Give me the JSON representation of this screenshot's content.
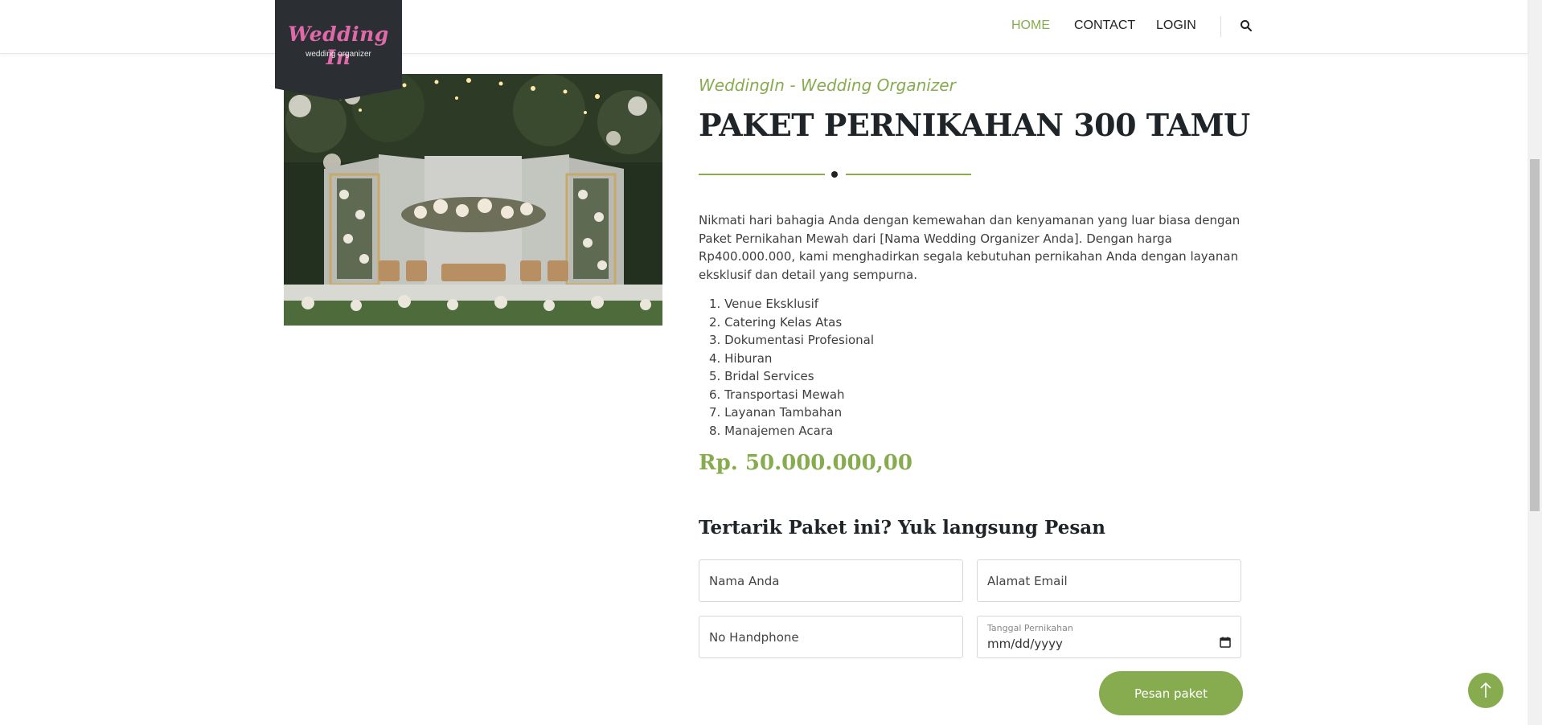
{
  "brand": {
    "title": "Wedding In",
    "subtitle": "wedding organizer",
    "colors": {
      "accent": "#87ac4f",
      "logo_bg": "#2b2f33",
      "logo_text": "#e06aa9",
      "heading": "#1f2428"
    }
  },
  "nav": {
    "items": [
      {
        "label": "HOME",
        "active": true
      },
      {
        "label": "CONTACT",
        "active": false
      },
      {
        "label": "LOGIN",
        "active": false
      }
    ],
    "search_icon": "search-icon"
  },
  "package": {
    "organizer": "WeddingIn - Wedding Organizer",
    "title": "PAKET PERNIKAHAN 300 TAMU",
    "description": "Nikmati hari bahagia Anda dengan kemewahan dan kenyamanan yang luar biasa dengan Paket Pernikahan Mewah dari [Nama Wedding Organizer Anda]. Dengan harga Rp400.000.000, kami menghadirkan segala kebutuhan pernikahan Anda dengan layanan eksklusif dan detail yang sempurna.",
    "features": [
      "1. Venue Eksklusif",
      "2. Catering Kelas Atas",
      "3. Dokumentasi Profesional",
      "4. Hiburan",
      "5. Bridal Services",
      "6. Transportasi Mewah",
      "7. Layanan Tambahan",
      "8. Manajemen Acara"
    ],
    "price": "Rp. 50.000.000,00",
    "image": "wedding-stage-photo"
  },
  "order_form": {
    "heading": "Tertarik Paket ini? Yuk langsung Pesan",
    "name_placeholder": "Nama Anda",
    "email_placeholder": "Alamat Email",
    "phone_placeholder": "No Handphone",
    "date_label": "Tanggal Pernikahan",
    "date_value": "mm/dd/yyyy",
    "submit_label": "Pesan paket"
  },
  "scroll_top_icon": "arrow-up-icon"
}
